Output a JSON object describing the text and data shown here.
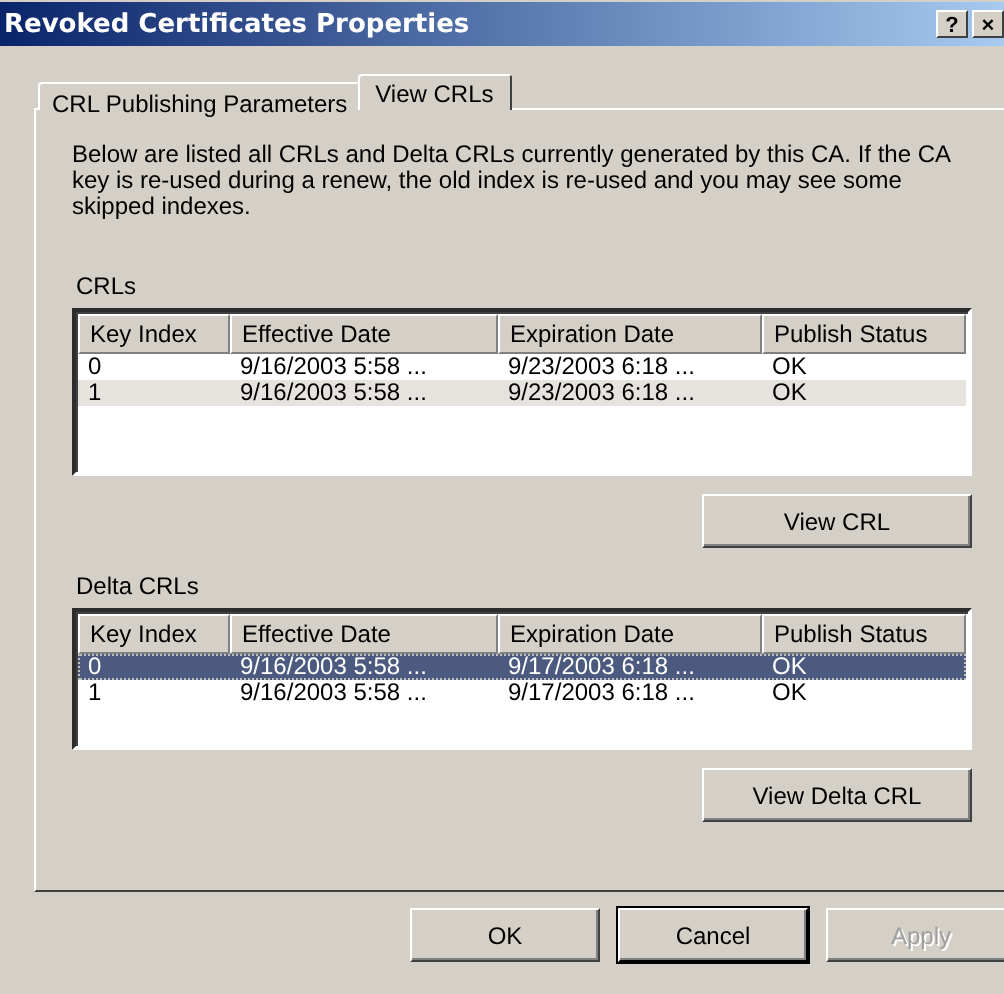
{
  "window": {
    "title": "Revoked Certificates Properties",
    "title_buttons": [
      "?",
      "×"
    ]
  },
  "tabs": [
    {
      "label": "CRL Publishing Parameters",
      "selected": false
    },
    {
      "label": "View CRLs",
      "selected": true
    }
  ],
  "description": "Below are listed all CRLs and Delta CRLs currently generated by this CA. If the CA key is re-used during a renew, the old index is re-used and you may see some skipped indexes.",
  "lists": [
    {
      "label": "CRLs",
      "focused": false,
      "columns": [
        "Key Index",
        "Effective Date",
        "Expiration Date",
        "Publish Status"
      ],
      "rows": [
        {
          "cells": [
            "0",
            "9/16/2003 5:58 ...",
            "9/23/2003 6:18 ...",
            "OK"
          ],
          "selected": false
        },
        {
          "cells": [
            "1",
            "9/16/2003 5:58 ...",
            "9/23/2003 6:18 ...",
            "OK"
          ],
          "selected": true
        }
      ],
      "button": {
        "label": "View CRL"
      }
    },
    {
      "label": "Delta CRLs",
      "focused": true,
      "columns": [
        "Key Index",
        "Effective Date",
        "Expiration Date",
        "Publish Status"
      ],
      "rows": [
        {
          "cells": [
            "0",
            "9/16/2003 5:58 ...",
            "9/17/2003 6:18 ...",
            "OK"
          ],
          "selected": true
        },
        {
          "cells": [
            "1",
            "9/16/2003 5:58 ...",
            "9/17/2003 6:18 ...",
            "OK"
          ],
          "selected": false
        }
      ],
      "button": {
        "label": "View Delta CRL"
      }
    }
  ],
  "buttons": [
    {
      "label": "OK",
      "focused": false,
      "disabled": false
    },
    {
      "label": "Cancel",
      "focused": true,
      "disabled": false
    },
    {
      "label": "Apply",
      "focused": false,
      "disabled": true
    }
  ]
}
